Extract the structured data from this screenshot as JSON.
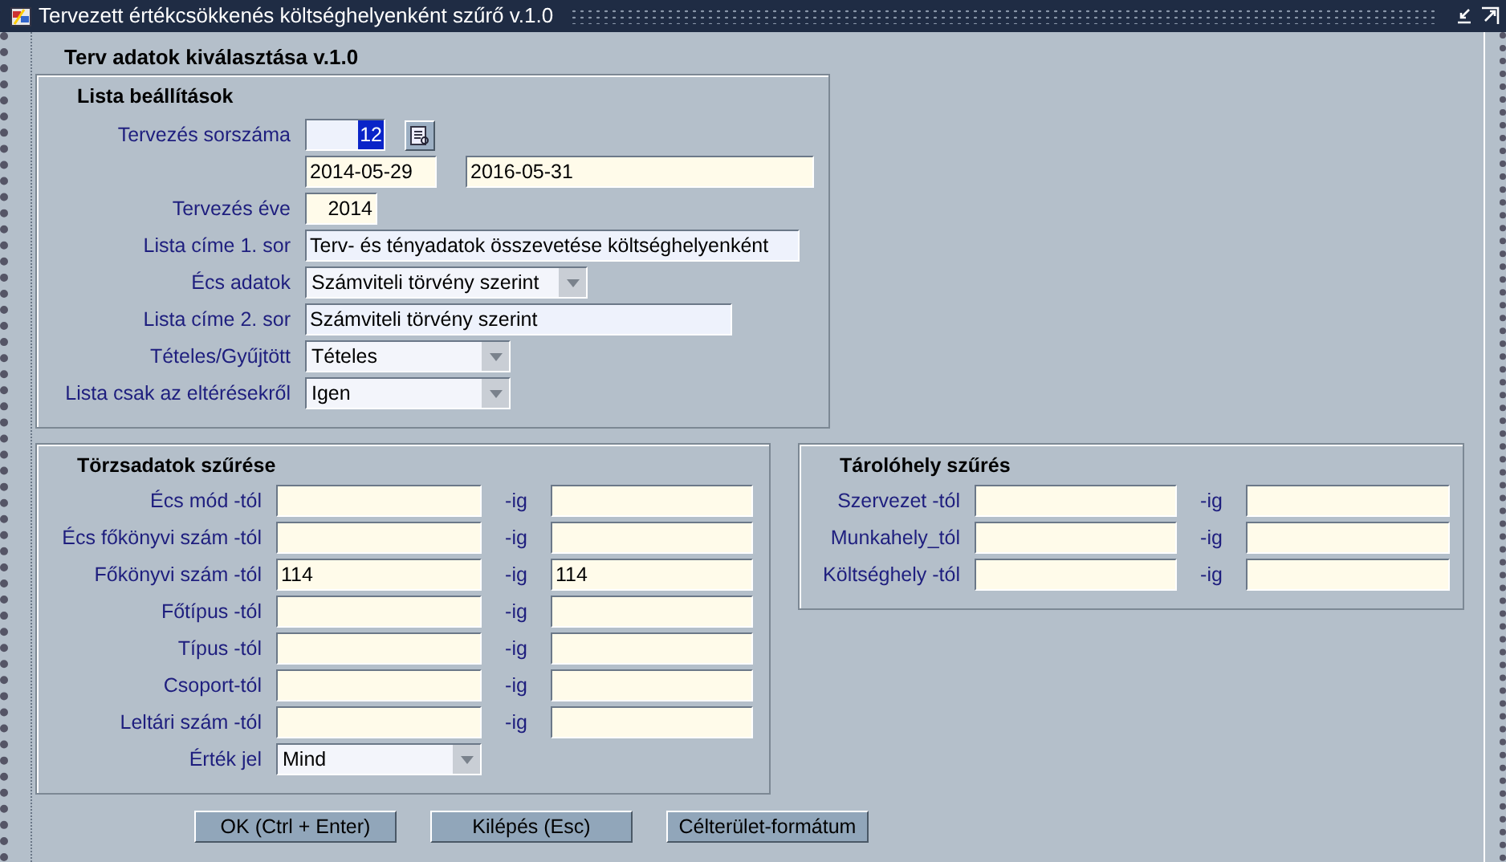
{
  "window": {
    "title": "Tervezett értékcsökkenés költséghelyenként szűrő v.1.0"
  },
  "header": "Terv adatok kiválasztása v.1.0",
  "list_settings": {
    "title": "Lista beállítások",
    "rows": [
      {
        "label": "Tervezés sorszáma",
        "fields": [
          {
            "kind": "lookup",
            "value": "12",
            "selected": true
          }
        ]
      },
      {
        "fields": [
          {
            "kind": "text",
            "value": "2014-05-29"
          },
          {
            "kind": "text",
            "value": "2016-05-31"
          }
        ]
      },
      {
        "label": "Tervezés éve",
        "fields": [
          {
            "kind": "number",
            "value": "2014"
          }
        ]
      },
      {
        "label": "Lista címe 1. sor",
        "fields": [
          {
            "kind": "light",
            "value": "Terv- és tényadatok összevetése költséghelyenként"
          }
        ]
      },
      {
        "label": "Écs adatok",
        "fields": [
          {
            "kind": "select",
            "value": "Számviteli törvény szerint"
          }
        ]
      },
      {
        "label": "Lista címe 2. sor",
        "fields": [
          {
            "kind": "light",
            "value": "Számviteli törvény szerint"
          }
        ]
      },
      {
        "label": "Tételes/Gyűjtött",
        "fields": [
          {
            "kind": "select",
            "value": "Tételes"
          }
        ]
      },
      {
        "label": "Lista csak az eltérésekről",
        "fields": [
          {
            "kind": "select",
            "value": "Igen"
          }
        ]
      }
    ]
  },
  "master_filter": {
    "title": "Törzsadatok szűrése",
    "rows": [
      {
        "kind": "range",
        "label": "Écs mód -tól",
        "to_label": "-ig"
      },
      {
        "kind": "range",
        "label": "Écs főkönyvi szám -tól",
        "to_label": "-ig"
      },
      {
        "kind": "range",
        "label": "Főkönyvi szám -tól",
        "from": "114",
        "to_label": "-ig",
        "to": "114"
      },
      {
        "kind": "range",
        "label": "Főtípus -tól",
        "to_label": "-ig"
      },
      {
        "kind": "range",
        "label": "Típus -tól",
        "to_label": "-ig"
      },
      {
        "kind": "range",
        "label": "Csoport-tól",
        "to_label": "-ig"
      },
      {
        "kind": "range",
        "label": "Leltári szám -tól",
        "to_label": "-ig"
      },
      {
        "kind": "select",
        "label": "Érték jel",
        "value": "Mind"
      }
    ]
  },
  "location_filter": {
    "title": "Tárolóhely szűrés",
    "rows": [
      {
        "kind": "range",
        "label": "Szervezet -tól",
        "to_label": "-ig"
      },
      {
        "kind": "range",
        "label": "Munkahely_tól",
        "to_label": "-ig"
      },
      {
        "kind": "range",
        "label": "Költséghely -tól",
        "to_label": "-ig"
      }
    ]
  },
  "buttons": [
    "OK (Ctrl + Enter)",
    "Kilépés (Esc)",
    "Célterület-formátum"
  ]
}
